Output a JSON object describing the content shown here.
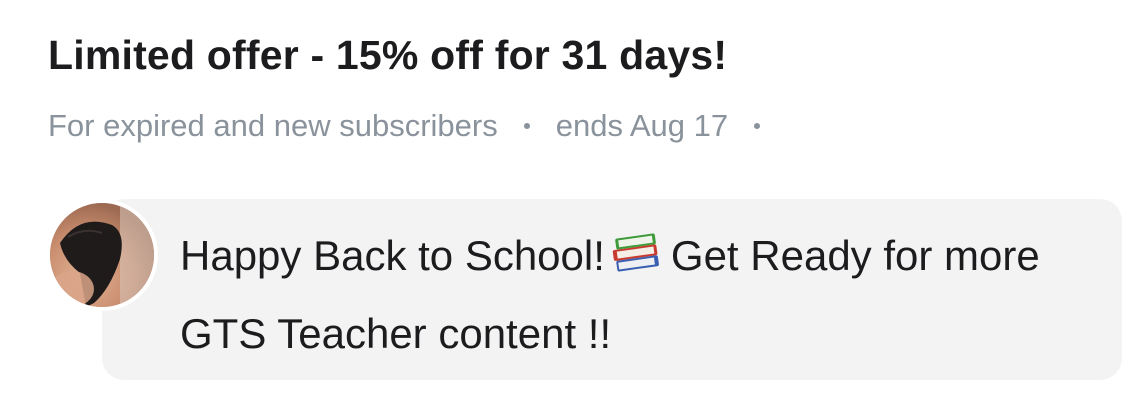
{
  "offer": {
    "title": "Limited offer - 15% off for 31 days!",
    "audience": "For expired and new subscribers",
    "ends": "ends Aug 17"
  },
  "message": {
    "text_before_icon": "Happy Back to School!",
    "icon": "books-icon",
    "text_after_icon": "Get Ready for more GTS Teacher content !!"
  },
  "colors": {
    "title": "#1c1c1e",
    "meta": "#8a939c",
    "bubble": "#f3f3f4"
  }
}
